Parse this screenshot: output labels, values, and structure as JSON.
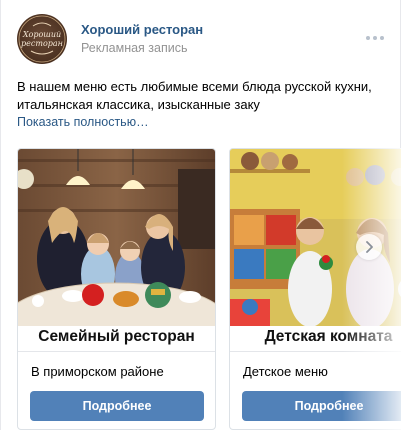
{
  "post": {
    "author": "Хороший ресторан",
    "ad_label": "Рекламная запись",
    "avatar_text_line1": "Хороший",
    "avatar_text_line2": "ресторан",
    "text_line1": "В нашем меню есть любимые всеми блюда русской кухни,",
    "text_line2": "итальянская классика, изысканные заку",
    "show_more": "Показать полностью…"
  },
  "carousel": {
    "cards": [
      {
        "image_caption": "Семейный ресторан",
        "title": "В приморском районе",
        "button": "Подробнее"
      },
      {
        "image_caption": "Детская комната",
        "title": "Детское меню",
        "button": "Подробнее"
      }
    ]
  },
  "icons": {
    "more": "more-dots-icon",
    "next": "chevron-right-icon"
  },
  "colors": {
    "link": "#2a5885",
    "button": "#5181b8",
    "secondary_text": "#939393"
  }
}
